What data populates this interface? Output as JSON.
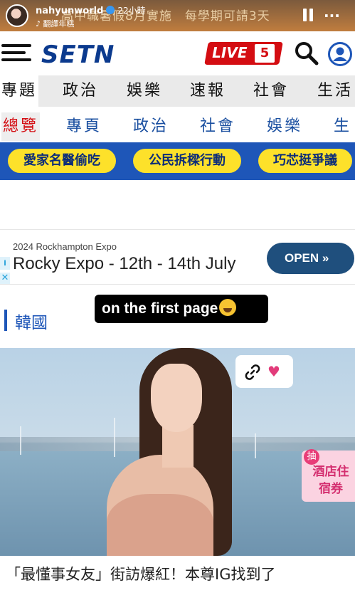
{
  "story": {
    "username": "nahyunworld",
    "time": "22小時",
    "music": "翻譯年糕",
    "marquee": "高中職暑假8月實施　每學期可請3天"
  },
  "header": {
    "logo": "SETN",
    "live_label": "LIVE",
    "live_number": "5"
  },
  "nav_primary": [
    "專題",
    "政治",
    "娛樂",
    "速報",
    "社會",
    "生活"
  ],
  "nav_secondary": [
    "總覽",
    "專頁",
    "政治",
    "社會",
    "娛樂",
    "生"
  ],
  "topics": [
    "愛家名醫偷吃",
    "公民拆樑行動",
    "巧芯挺爭議"
  ],
  "ad": {
    "small_text": "2024 Rockhampton Expo",
    "title": "Rocky Expo - 12th - 14th July",
    "button": "OPEN »"
  },
  "section_title": "韓國",
  "sticker_text": "on the first page",
  "promo": {
    "tag": "抽",
    "text": "酒店住宿券"
  },
  "headline": "「最懂事女友」街訪爆紅！本尊IG找到了",
  "colors": {
    "brand_blue": "#1e56b8",
    "live_red": "#d40d12",
    "pill_yellow": "#fde12a"
  }
}
